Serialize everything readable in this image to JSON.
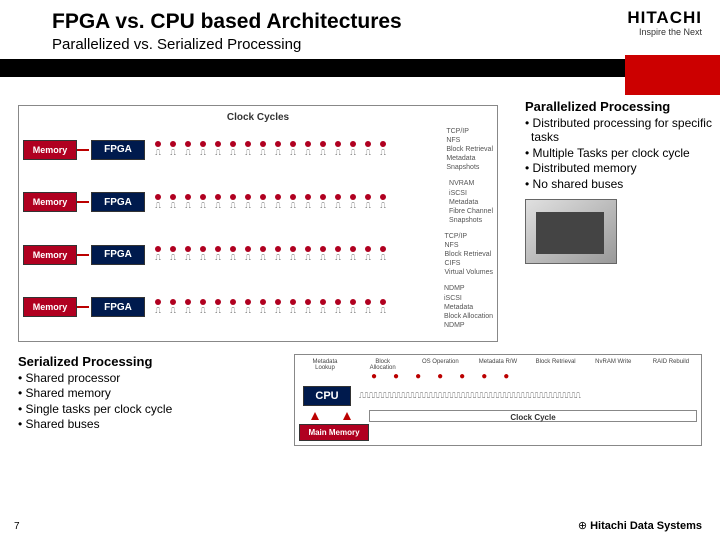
{
  "header": {
    "title": "FPGA vs. CPU based Architectures",
    "subtitle": "Parallelized vs. Serialized Processing",
    "logo_main": "HITACHI",
    "logo_tag": "Inspire the Next"
  },
  "fpga": {
    "clock_label": "Clock Cycles",
    "mem_label": "Memory",
    "fpga_label": "FPGA",
    "rows": [
      {
        "tasks": [
          "TCP/IP",
          "NFS",
          "Block Retrieval",
          "Metadata",
          "Snapshots"
        ]
      },
      {
        "tasks": [
          "NVRAM",
          "iSCSI",
          "Metadata",
          "Fibre Channel",
          "Snapshots"
        ]
      },
      {
        "tasks": [
          "TCP/IP",
          "NFS",
          "Block Retrieval",
          "CIFS",
          "Virtual Volumes"
        ]
      },
      {
        "tasks": [
          "NDMP",
          "iSCSI",
          "Metadata",
          "Block Allocation",
          "NDMP"
        ]
      }
    ]
  },
  "parallel": {
    "heading": "Parallelized Processing",
    "bullets": [
      "Distributed processing for specific tasks",
      "Multiple Tasks per clock cycle",
      "Distributed memory",
      "No shared buses"
    ]
  },
  "serial": {
    "heading": "Serialized Processing",
    "bullets": [
      "Shared processor",
      "Shared memory",
      "Single tasks per clock cycle",
      "Shared buses"
    ]
  },
  "cpu": {
    "box_label": "CPU",
    "mem_label": "Main Memory",
    "cycle_label": "Clock Cycle",
    "phases": [
      "Metadata Lookup",
      "Block Allocation",
      "OS Operation",
      "Metadata R/W",
      "Block Retrieval",
      "NvRAM Write",
      "RAID Rebuild"
    ]
  },
  "footer": {
    "page": "7",
    "brand": "Hitachi Data Systems"
  }
}
